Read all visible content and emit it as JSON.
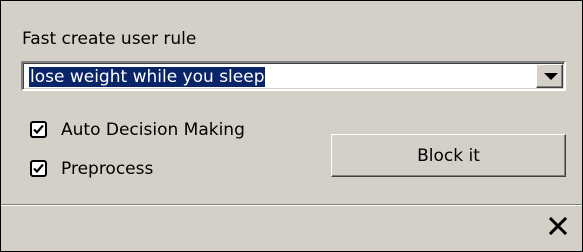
{
  "panel": {
    "title": "Fast create user rule"
  },
  "combo": {
    "value": "lose weight while you sleep",
    "drop_icon": "chevron-down-icon"
  },
  "options": {
    "auto_decision": {
      "label": "Auto Decision Making",
      "checked": true
    },
    "preprocess": {
      "label": "Preprocess",
      "checked": true
    }
  },
  "actions": {
    "block_label": "Block it",
    "close_icon": "close-icon"
  }
}
